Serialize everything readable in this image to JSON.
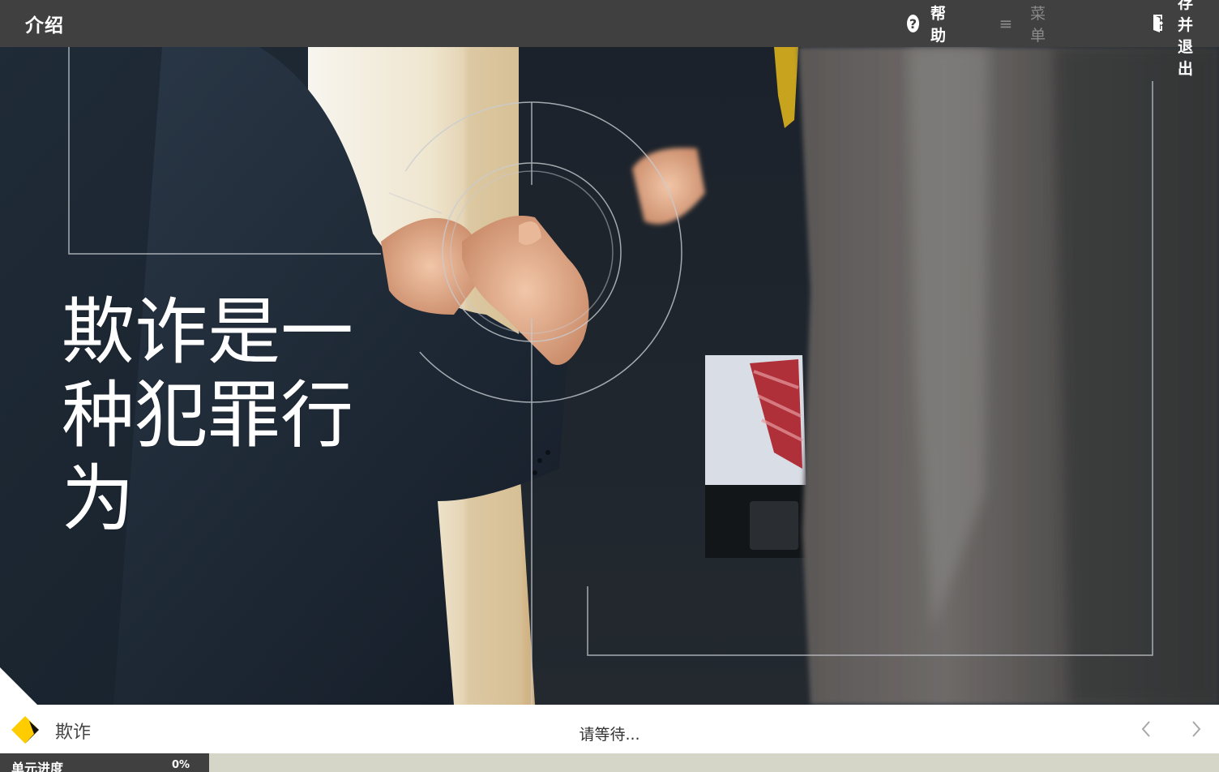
{
  "header": {
    "title": "介绍",
    "help_label": "帮助",
    "menu_label": "菜单",
    "exit_label": "保存并退出"
  },
  "hero": {
    "headline_lines": [
      "欺诈是一",
      "种犯罪行",
      "为"
    ]
  },
  "footer": {
    "module_name": "欺诈",
    "status": "请等待..."
  },
  "progress": {
    "label": "单元进度",
    "percent_text": "0%",
    "value": 0
  },
  "colors": {
    "topbar": "#404040",
    "accent": "#ffcc00",
    "progress_track": "#d6d6c8"
  },
  "icons": {
    "help": "question-circle-icon",
    "menu": "hamburger-icon",
    "exit": "door-exit-icon",
    "prev": "chevron-left-icon",
    "next": "chevron-right-icon",
    "logo": "diamond-logo"
  }
}
